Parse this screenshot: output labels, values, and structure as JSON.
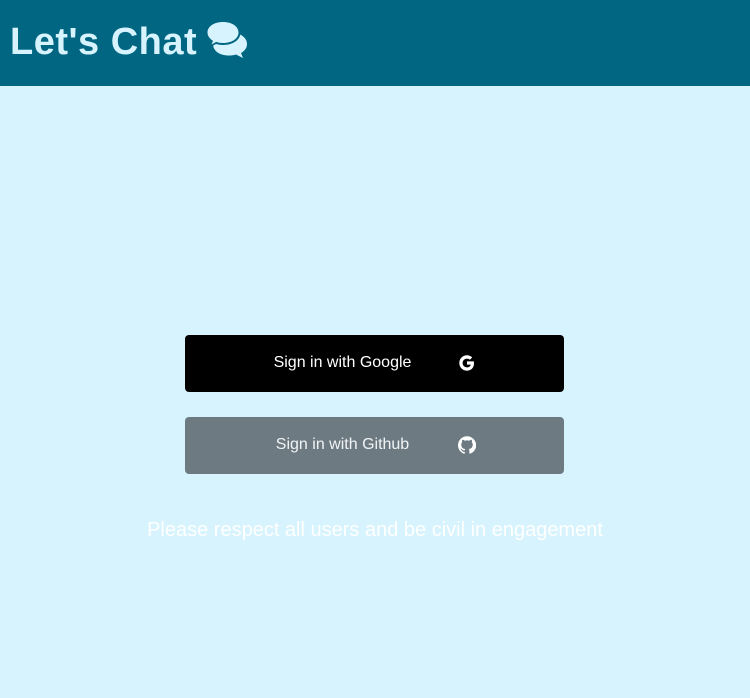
{
  "header": {
    "title": "Let's Chat",
    "icon": "comments-icon",
    "background": "#006682",
    "text_color": "#d6f3fe"
  },
  "auth": {
    "google": {
      "label": "Sign in with Google",
      "icon": "google-icon",
      "background": "#000000"
    },
    "github": {
      "label": "Sign in with Github",
      "icon": "github-icon",
      "background": "#6d7a82"
    }
  },
  "notice": "Please respect all users and be civil in engagement",
  "page": {
    "background": "#d6f3fe"
  }
}
